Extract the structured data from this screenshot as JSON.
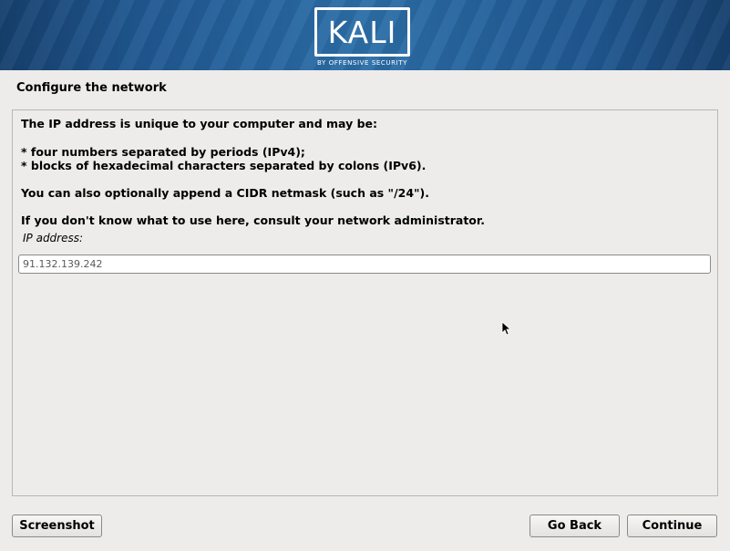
{
  "banner": {
    "logo": "KALI",
    "tagline": "BY OFFENSIVE SECURITY"
  },
  "title": "Configure the network",
  "description": {
    "line1": "The IP address is unique to your computer and may be:",
    "bullet1": " * four numbers separated by periods (IPv4);",
    "bullet2": " * blocks of hexadecimal characters separated by colons (IPv6).",
    "line2": "You can also optionally append a CIDR netmask (such as \"/24\").",
    "line3": "If you don't know what to use here, consult your network administrator."
  },
  "ip_field": {
    "label": "IP address:",
    "value": "91.132.139.242"
  },
  "buttons": {
    "screenshot": "Screenshot",
    "go_back": "Go Back",
    "continue": "Continue"
  },
  "icons": {
    "pointer": "mouse-pointer-icon"
  }
}
